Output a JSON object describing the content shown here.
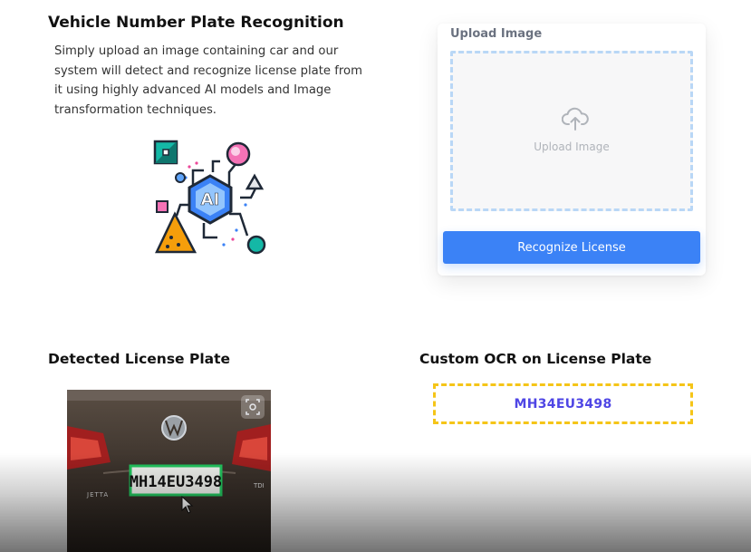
{
  "header": {
    "title": "Vehicle Number Plate Recognition",
    "description": "Simply upload an image containing car and our system will detect and recognize license plate from it using highly advanced AI models and Image transformation techniques."
  },
  "illustration": {
    "ai_label": "AI"
  },
  "upload": {
    "label": "Upload Image",
    "dropzone_text": "Upload Image",
    "button_label": "Recognize License"
  },
  "detected": {
    "title": "Detected License Plate",
    "plate_text": "MH14EU3498",
    "car_model": "JETTA",
    "badge": "TDI"
  },
  "ocr": {
    "title": "Custom OCR on License Plate",
    "result": "MH34EU3498"
  },
  "colors": {
    "accent": "#3b82f6",
    "ocr_border": "#f5c518",
    "ocr_text": "#4f46e5",
    "dropzone_border": "#b9d7f6",
    "detection_box": "#22c55e"
  }
}
